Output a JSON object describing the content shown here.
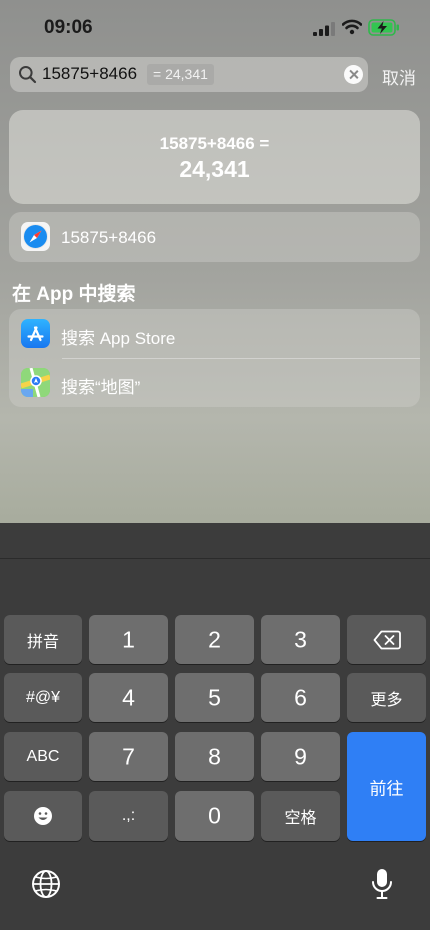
{
  "status": {
    "time": "09:06"
  },
  "search": {
    "query": "15875+8466",
    "inline_result": "= 24,341",
    "cancel_label": "取消"
  },
  "calculator": {
    "expression": "15875+8466 =",
    "result": "24,341"
  },
  "web_suggestion": {
    "label": "15875+8466",
    "icon": "safari-icon"
  },
  "in_app_section": {
    "title": "在 App 中搜索",
    "items": [
      {
        "label": "搜索 App Store",
        "icon": "app-store-icon"
      },
      {
        "label": "搜索“地图”",
        "icon": "maps-icon"
      }
    ]
  },
  "keyboard": {
    "row1": [
      "拼音",
      "1",
      "2",
      "3"
    ],
    "row2": [
      "#@¥",
      "4",
      "5",
      "6",
      "更多"
    ],
    "row3": [
      "ABC",
      "7",
      "8",
      "9"
    ],
    "row4": [
      ".,:",
      "0",
      "空格"
    ],
    "go_label": "前往",
    "emoji_icon": "emoji-icon",
    "delete_icon": "delete-icon",
    "globe_icon": "globe-icon",
    "mic_icon": "microphone-icon"
  },
  "colors": {
    "accent": "#2f7ff5",
    "keyboard_bg": "#3c3c3c"
  }
}
